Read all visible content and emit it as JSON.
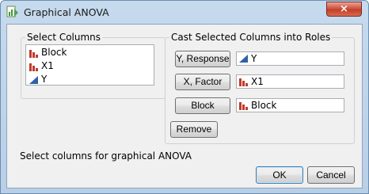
{
  "window": {
    "title": "Graphical ANOVA",
    "close_symbol": "×",
    "app_icon": "graph-builder-icon"
  },
  "select_columns": {
    "legend": "Select Columns",
    "items": [
      {
        "label": "Block",
        "icon": "nominal-bar-icon"
      },
      {
        "label": "X1",
        "icon": "nominal-bar-icon"
      },
      {
        "label": "Y",
        "icon": "continuous-triangle-icon"
      }
    ]
  },
  "roles": {
    "legend": "Cast Selected Columns into Roles",
    "rows": [
      {
        "button": "Y, Response",
        "value": "Y",
        "icon": "continuous-triangle-icon"
      },
      {
        "button": "X, Factor",
        "value": "X1",
        "icon": "nominal-bar-icon"
      },
      {
        "button": "Block",
        "value": "Block",
        "icon": "nominal-bar-icon"
      }
    ],
    "remove": "Remove"
  },
  "status": "Select columns for graphical ANOVA",
  "actions": {
    "ok": "OK",
    "cancel": "Cancel"
  },
  "colors": {
    "nominal_red": "#c0392b",
    "continuous_blue": "#2f5fa8"
  }
}
